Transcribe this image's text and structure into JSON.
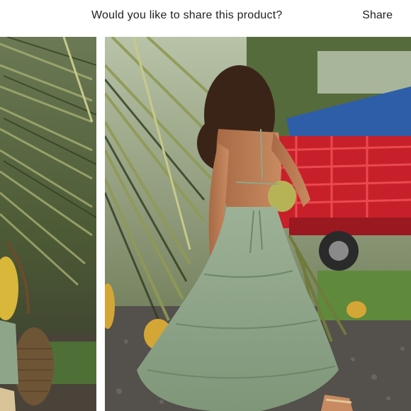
{
  "header": {
    "prompt_text": "Would you like to share this product?",
    "share_label": "Share"
  },
  "gallery": {
    "images": [
      {
        "name": "product-photo-partial",
        "subject": "palm leaves, woven basket bag, sage green dress hem"
      },
      {
        "name": "product-photo-main",
        "subject": "woman in sage green tiered halter maxi dress holding a coconut near a red truck"
      }
    ]
  },
  "colors": {
    "dress": "#8fa58a",
    "palm_dark": "#3d4f2a",
    "truck_red": "#c8202a",
    "tarp_blue": "#2f5ea8",
    "gravel": "#5a5350"
  }
}
